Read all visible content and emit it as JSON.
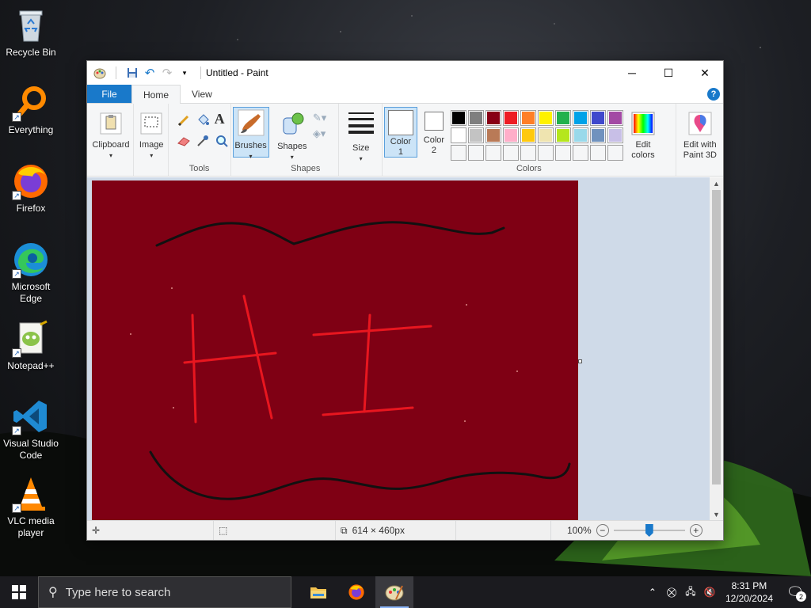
{
  "desktop": {
    "icons": [
      {
        "label": "Recycle Bin",
        "icon": "recycle-bin-icon"
      },
      {
        "label": "Everything",
        "icon": "everything-search-icon"
      },
      {
        "label": "Firefox",
        "icon": "firefox-icon"
      },
      {
        "label": "Microsoft Edge",
        "icon": "edge-icon"
      },
      {
        "label": "Notepad++",
        "icon": "notepadpp-icon"
      },
      {
        "label": "Visual Studio Code",
        "icon": "vscode-icon"
      },
      {
        "label": "VLC media player",
        "icon": "vlc-icon"
      }
    ]
  },
  "paint": {
    "title": "Untitled - Paint",
    "tabs": {
      "file": "File",
      "home": "Home",
      "view": "View"
    },
    "help": "?",
    "ribbon": {
      "clipboard": "Clipboard",
      "image": "Image",
      "tools": "Tools",
      "brushes": "Brushes",
      "shapes_btn": "Shapes",
      "shapes_group": "Shapes",
      "size": "Size",
      "color1": "Color 1",
      "color2": "Color 2",
      "colors_group": "Colors",
      "edit_colors": "Edit colors",
      "edit_paint3d": "Edit with Paint 3D"
    },
    "palette_row1": [
      "#000000",
      "#7f7f7f",
      "#880015",
      "#ed1c24",
      "#ff7f27",
      "#fff200",
      "#22b14c",
      "#00a2e8",
      "#3f48cc",
      "#a349a4"
    ],
    "palette_row2": [
      "#ffffff",
      "#c3c3c3",
      "#b97a57",
      "#ffaec9",
      "#ffc90e",
      "#efe4b0",
      "#b5e61d",
      "#99d9ea",
      "#7092be",
      "#c8bfe7"
    ],
    "canvas_color": "#7f0014",
    "status": {
      "dimensions": "614 × 460px",
      "zoom": "100%",
      "zoom_fraction": 0.5
    }
  },
  "taskbar": {
    "search_placeholder": "Type here to search",
    "time": "8:31 PM",
    "date": "12/20/2024",
    "notifications": "2"
  }
}
